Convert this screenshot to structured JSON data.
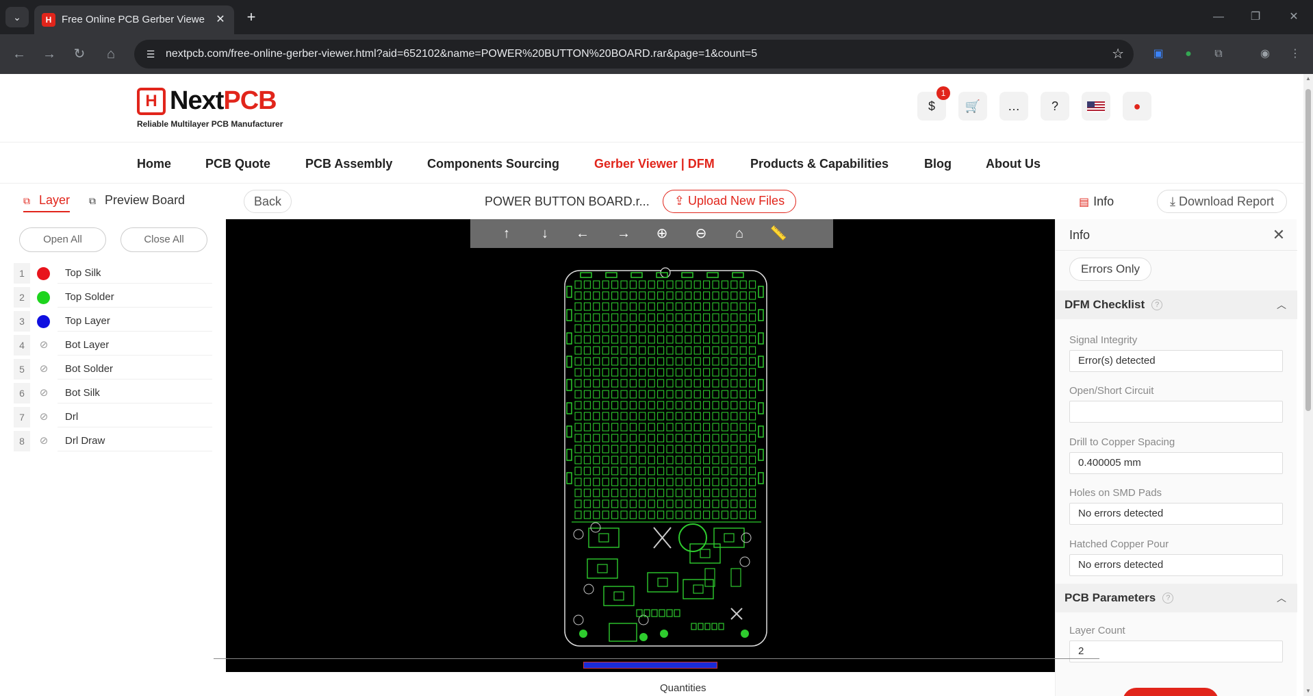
{
  "browser": {
    "tab_title": "Free Online PCB Gerber Viewer",
    "url": "nextpcb.com/free-online-gerber-viewer.html?aid=652102&name=POWER%20BUTTON%20BOARD.rar&page=1&count=5"
  },
  "header": {
    "logo_mark": "H",
    "logo_next": "Next",
    "logo_pcb": "PCB",
    "tagline": "Reliable Multilayer PCB Manufacturer",
    "cart_badge": "1"
  },
  "nav": {
    "items": [
      "Home",
      "PCB Quote",
      "PCB Assembly",
      "Components Sourcing",
      "Gerber Viewer | DFM",
      "Products & Capabilities",
      "Blog",
      "About Us"
    ],
    "active": "Gerber Viewer | DFM"
  },
  "viewer": {
    "tab_layer": "Layer",
    "tab_preview": "Preview Board",
    "back": "Back",
    "filename": "POWER BUTTON BOARD.r...",
    "upload": "Upload New Files",
    "info": "Info",
    "download": "Download Report"
  },
  "layers": {
    "open_all": "Open All",
    "close_all": "Close All",
    "items": [
      {
        "num": "1",
        "name": "Top Silk",
        "color": "#e8141c",
        "visible": true
      },
      {
        "num": "2",
        "name": "Top Solder",
        "color": "#1ed41e",
        "visible": true
      },
      {
        "num": "3",
        "name": "Top Layer",
        "color": "#1010e0",
        "visible": true
      },
      {
        "num": "4",
        "name": "Bot Layer",
        "visible": false
      },
      {
        "num": "5",
        "name": "Bot Solder",
        "visible": false
      },
      {
        "num": "6",
        "name": "Bot Silk",
        "visible": false
      },
      {
        "num": "7",
        "name": "Drl",
        "visible": false
      },
      {
        "num": "8",
        "name": "Drl Draw",
        "visible": false
      }
    ]
  },
  "canvas_tools": [
    "arrow-up-icon",
    "arrow-down-icon",
    "arrow-left-icon",
    "arrow-right-icon",
    "zoom-in-icon",
    "zoom-out-icon",
    "home-icon",
    "ruler-icon"
  ],
  "info_panel": {
    "title": "Info",
    "errors_only": "Errors Only",
    "dfm_title": "DFM Checklist",
    "dfm_fields": [
      {
        "label": "Signal Integrity",
        "value": "Error(s) detected"
      },
      {
        "label": "Open/Short Circuit",
        "value": ""
      },
      {
        "label": "Drill to Copper Spacing",
        "value": "0.400005 mm"
      },
      {
        "label": "Holes on SMD Pads",
        "value": "No errors detected"
      },
      {
        "label": "Hatched Copper Pour",
        "value": "No errors detected"
      }
    ],
    "params_title": "PCB Parameters",
    "params_fields": [
      {
        "label": "Layer Count",
        "value": "2"
      }
    ]
  },
  "footer": {
    "quantities": "Quantities"
  },
  "colors": {
    "brand_red": "#e1251b",
    "pcb_green": "#2ecc2e",
    "canvas_bg": "#000000"
  }
}
